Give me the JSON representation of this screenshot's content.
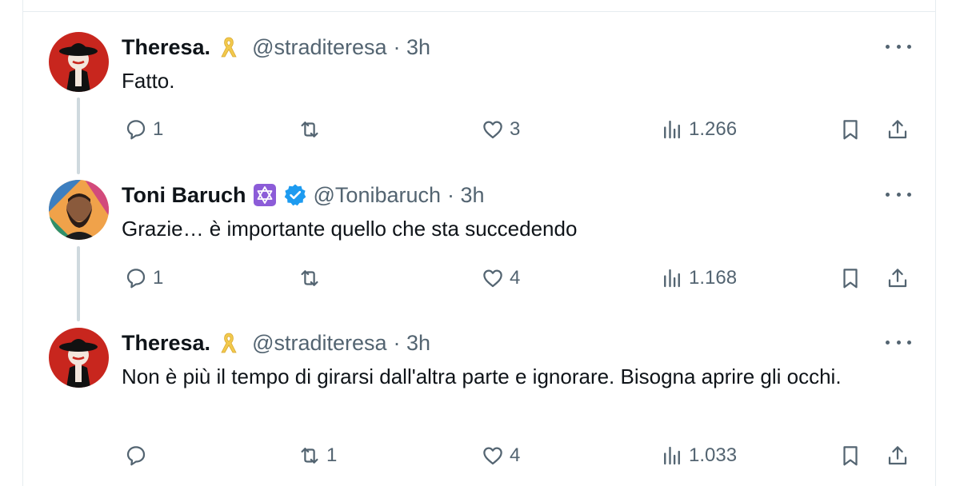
{
  "tweets": [
    {
      "name": "Theresa.",
      "handle": "@straditeresa",
      "time": "· 3h",
      "text": "Fatto.",
      "replies": "1",
      "retweets": "",
      "likes": "3",
      "views": "1.266",
      "badges": [
        "yellow-ribbon-icon"
      ]
    },
    {
      "name": "Toni Baruch",
      "handle": "@Tonibaruch",
      "time": "· 3h",
      "text": "Grazie… è importante quello che sta succedendo",
      "replies": "1",
      "retweets": "",
      "likes": "4",
      "views": "1.168",
      "badges": [
        "star-of-david-icon",
        "verified-badge-icon"
      ]
    },
    {
      "name": "Theresa.",
      "handle": "@straditeresa",
      "time": "· 3h",
      "text": "Non è più il tempo di girarsi dall'altra parte e ignorare. Bisogna aprire gli occhi.",
      "replies": "",
      "retweets": "1",
      "likes": "4",
      "views": "1.033",
      "badges": [
        "yellow-ribbon-icon"
      ]
    }
  ],
  "colors": {
    "text_primary": "#0f1419",
    "text_secondary": "#536471",
    "verified_blue": "#1d9bf0",
    "star_badge_purple": "#8c5cd8",
    "ribbon_yellow": "#f2c94c",
    "thread_line": "#cfd9de"
  }
}
